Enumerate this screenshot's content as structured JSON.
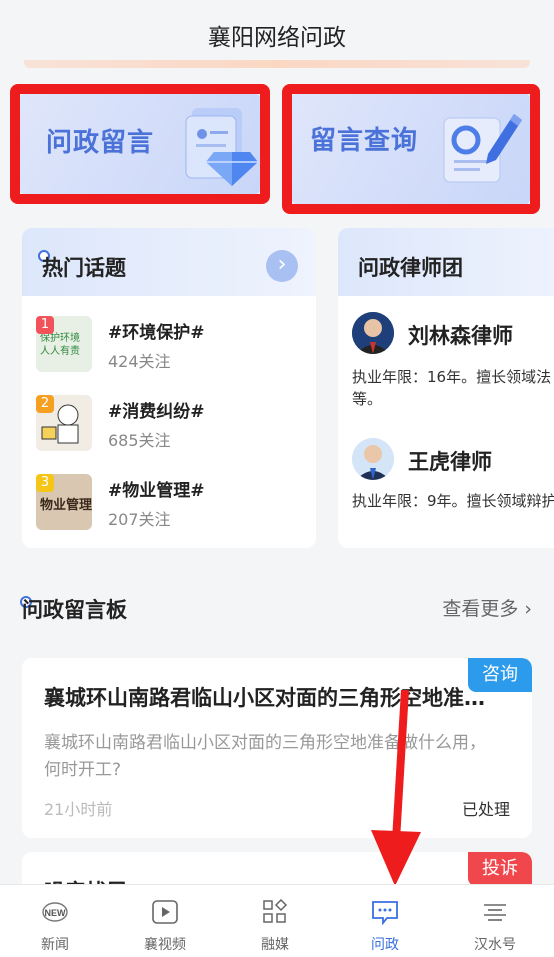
{
  "header": {
    "title": "襄阳网络问政"
  },
  "features": [
    {
      "label": "问政留言"
    },
    {
      "label": "留言查询"
    }
  ],
  "hot_topics": {
    "title": "热门话题",
    "items": [
      {
        "rank": "1",
        "name": "#环境保护#",
        "follows": "424关注",
        "thumb_text": "保护环境 人人有责"
      },
      {
        "rank": "2",
        "name": "#消费纠纷#",
        "follows": "685关注",
        "thumb_text": ""
      },
      {
        "rank": "3",
        "name": "#物业管理#",
        "follows": "207关注",
        "thumb_text": "物业管理"
      }
    ]
  },
  "lawyers": {
    "title": "问政律师团",
    "items": [
      {
        "name": "刘林森律师",
        "desc": "执业年限：16年。擅长领域法等。"
      },
      {
        "name": "王虎律师",
        "desc": "执业年限：9年。擅长领域辩护"
      }
    ]
  },
  "board": {
    "title": "问政留言板",
    "more": "查看更多",
    "more_icon": "chevron-right-icon"
  },
  "messages": [
    {
      "tag": "咨询",
      "tag_color": "#2d9bec",
      "title": "襄城环山南路君临山小区对面的三角形空地准备做什么用，何时开工?",
      "content": "襄城环山南路君临山小区对面的三角形空地准备做什么用，何时开工?",
      "time": "21小时前",
      "status": "已处理"
    },
    {
      "tag": "投诉",
      "tag_color": "#f0474c",
      "title": "噪音扰民",
      "content": "",
      "time": "",
      "status": ""
    }
  ],
  "tabs": [
    {
      "label": "新闻",
      "icon": "news-icon"
    },
    {
      "label": "襄视频",
      "icon": "video-icon"
    },
    {
      "label": "融媒",
      "icon": "apps-icon"
    },
    {
      "label": "问政",
      "icon": "message-icon"
    },
    {
      "label": "汉水号",
      "icon": "lines-icon"
    }
  ],
  "colors": {
    "accent": "#3a6fe0",
    "highlight_border": "#ee1c1c",
    "annotation_arrow": "#ee1c1c"
  }
}
